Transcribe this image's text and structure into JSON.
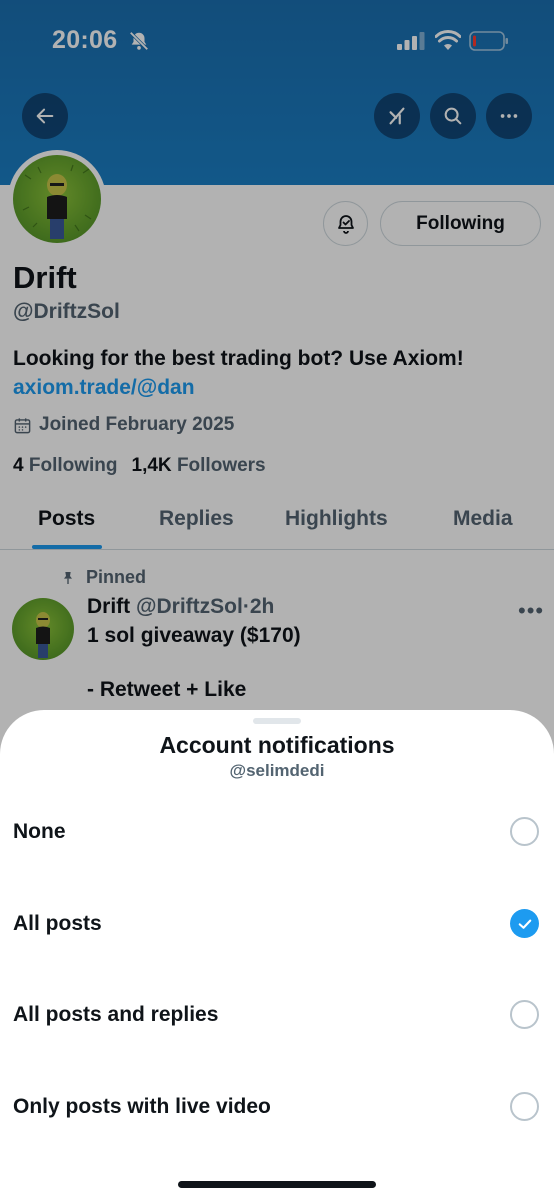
{
  "status_bar": {
    "time": "20:06"
  },
  "header": {
    "back_icon": "arrow-left-icon",
    "grok_icon": "grok-icon",
    "search_icon": "search-icon",
    "more_icon": "more-horizontal-icon",
    "banner_color": "#1a7ec4"
  },
  "profile": {
    "name": "Drift",
    "handle": "@DriftzSol",
    "bio": "Looking for the best trading bot? Use Axiom!",
    "link": "axiom.trade/@dan",
    "joined": "Joined February 2025",
    "following_count": "4",
    "following_label": "Following",
    "followers_count": "1,4K",
    "followers_label": "Followers",
    "follow_button": "Following"
  },
  "tabs": [
    {
      "label": "Posts",
      "active": true
    },
    {
      "label": "Replies",
      "active": false
    },
    {
      "label": "Highlights",
      "active": false
    },
    {
      "label": "Media",
      "active": false
    }
  ],
  "post": {
    "pinned_label": "Pinned",
    "author": "Drift",
    "handle": "@DriftzSol",
    "time": "2h",
    "line1": "1 sol giveaway ($170)",
    "line2": "- Retweet + Like"
  },
  "sheet": {
    "title": "Account notifications",
    "subtitle": "@selimdedi",
    "options": [
      {
        "label": "None",
        "selected": false
      },
      {
        "label": "All posts",
        "selected": true
      },
      {
        "label": "All posts and replies",
        "selected": false
      },
      {
        "label": "Only posts with live video",
        "selected": false
      }
    ]
  },
  "colors": {
    "accent": "#1d9bf0",
    "text": "#0f1419",
    "muted": "#536471"
  }
}
